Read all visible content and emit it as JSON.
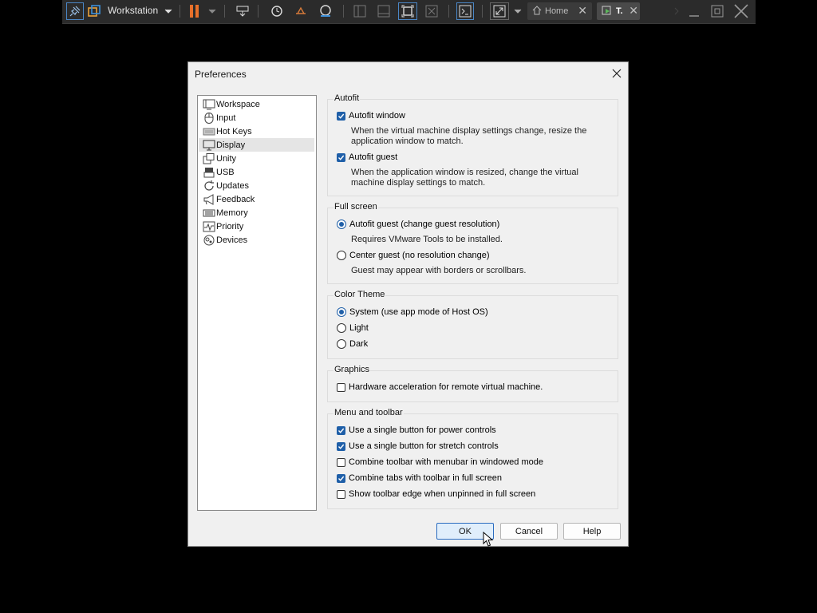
{
  "toolbar": {
    "app_name": "Workstation",
    "tabs": [
      {
        "label": "Home",
        "icon": "home-icon"
      },
      {
        "label": "T.",
        "icon": "vm-tab-icon"
      }
    ],
    "accent_pause": "#e8702a"
  },
  "dialog": {
    "title": "Preferences",
    "nav": [
      {
        "label": "Workspace",
        "icon": "workspace-icon"
      },
      {
        "label": "Input",
        "icon": "mouse-icon"
      },
      {
        "label": "Hot Keys",
        "icon": "keyboard-icon"
      },
      {
        "label": "Display",
        "icon": "monitor-icon",
        "selected": true
      },
      {
        "label": "Unity",
        "icon": "unity-icon"
      },
      {
        "label": "USB",
        "icon": "usb-icon"
      },
      {
        "label": "Updates",
        "icon": "refresh-icon"
      },
      {
        "label": "Feedback",
        "icon": "megaphone-icon"
      },
      {
        "label": "Memory",
        "icon": "memory-icon"
      },
      {
        "label": "Priority",
        "icon": "priority-icon"
      },
      {
        "label": "Devices",
        "icon": "devices-icon"
      }
    ],
    "autofit": {
      "title": "Autofit",
      "autofit_window": {
        "label": "Autofit window",
        "checked": true,
        "desc": "When the virtual machine display settings change, resize the application window to match."
      },
      "autofit_guest": {
        "label": "Autofit guest",
        "checked": true,
        "desc": "When the application window is resized, change the virtual machine display settings to match."
      }
    },
    "fullscreen": {
      "title": "Full screen",
      "autofit": {
        "label": "Autofit guest (change guest resolution)",
        "selected": true,
        "desc": "Requires VMware Tools to be installed."
      },
      "center": {
        "label": "Center guest (no resolution change)",
        "selected": false,
        "desc": "Guest may appear with borders or scrollbars."
      }
    },
    "theme": {
      "title": "Color Theme",
      "system": {
        "label": "System (use app mode of Host OS)",
        "selected": true
      },
      "light": {
        "label": "Light",
        "selected": false
      },
      "dark": {
        "label": "Dark",
        "selected": false
      }
    },
    "graphics": {
      "title": "Graphics",
      "hw_accel": {
        "label": "Hardware acceleration for remote virtual machine.",
        "checked": false
      }
    },
    "menu_toolbar": {
      "title": "Menu and toolbar",
      "items": [
        {
          "label": "Use a single button for power controls",
          "checked": true
        },
        {
          "label": "Use a single button for stretch controls",
          "checked": true
        },
        {
          "label": "Combine toolbar with menubar in windowed mode",
          "checked": false
        },
        {
          "label": "Combine tabs with toolbar in full screen",
          "checked": true
        },
        {
          "label": "Show toolbar edge when unpinned in full screen",
          "checked": false
        }
      ]
    },
    "buttons": {
      "ok": "OK",
      "cancel": "Cancel",
      "help": "Help"
    },
    "accent": "#1f5fa8"
  }
}
